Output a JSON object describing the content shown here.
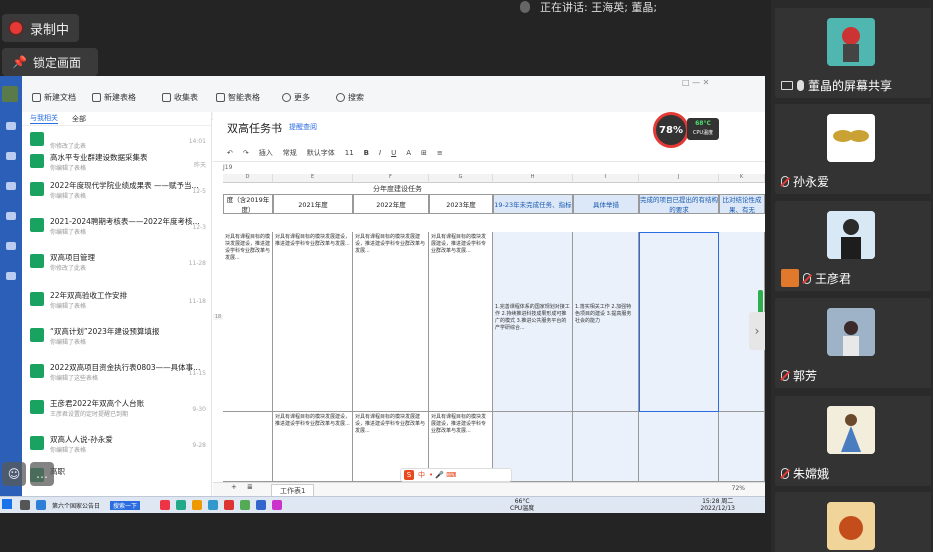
{
  "overlay": {
    "recording_label": "录制中",
    "lock_label": "锁定画面",
    "speaking_label": "正在讲话: 王海英; 董晶;"
  },
  "shared_app": {
    "toolbar": {
      "new_doc": "新建文档",
      "new_sheet": "新建表格",
      "inbox": "收集表",
      "smart_table": "智能表格",
      "more": "更多",
      "search": "搜索"
    },
    "doclist": {
      "tabs": [
        "与我相关",
        "全部"
      ],
      "items": [
        {
          "title": "",
          "sub": "你修改了此表",
          "date": "14:01"
        },
        {
          "title": "高水平专业群建设数据采集表",
          "sub": "你编辑了表格",
          "date": "昨天"
        },
        {
          "title": "2022年度现代学院业绩成果表 ——赋予当...",
          "sub": "你编辑了表格",
          "date": "12-5"
        },
        {
          "title": "2021-2024聘期考核表——2022年度考核...",
          "sub": "你编辑了表格",
          "date": "12-3"
        },
        {
          "title": "双高项目管理",
          "sub": "你修改了此表",
          "date": "11-28"
        },
        {
          "title": "22年双高验收工作安排",
          "sub": "你编辑了表格",
          "date": "11-18"
        },
        {
          "title": "“双高计划”2023年建设预算填报",
          "sub": "你编辑了表格",
          "date": ""
        },
        {
          "title": "2022双高项目资金执行表0803——具体事...",
          "sub": "你编辑了这些表格",
          "date": "11-15"
        },
        {
          "title": "王彦君2022年双高个人台账",
          "sub": "王彦君设置的定时提醒已到期",
          "date": "9-30"
        },
        {
          "title": "双高人人说-孙永爱",
          "sub": "你编辑了表格",
          "date": "9-28"
        },
        {
          "title": "高职",
          "sub": "",
          "date": ""
        }
      ]
    },
    "sheet": {
      "title": "双高任务书",
      "tag": "提醒查阅",
      "cell_ref": "J19",
      "cpu_percent": "78%",
      "cpu_temp": "68°C",
      "cpu_temp_label": "CPU温度",
      "format": {
        "insert": "插入",
        "style": "常规",
        "font": "默认字体",
        "size": "11"
      },
      "header_title": "分年度建设任务",
      "columns": [
        "D",
        "E",
        "F",
        "G",
        "H",
        "I",
        "J",
        "K"
      ],
      "headers": [
        "度（含2019年度）",
        "2021年度",
        "2022年度",
        "2023年度",
        "19-23年未完成任务、指标",
        "具体举措",
        "完成的项目已提出的有结构的要求",
        "比对结论性成果、有无"
      ],
      "row_number": "18",
      "row_text": "对具有课程目标的模块发展建设，推进建设学科专业群改革与发展...",
      "h_text": "1.完善课程体系的国家规划对接工作 2.持续推进科技成果形成可推广的模式 3.推进公共服务平台的产学研综合...",
      "i_text": "1.落实相关工作 2.加强特色项目的建设 3.提高服务社会的能力",
      "sheet_tab": "工作表1",
      "zoom": "72%"
    },
    "taskbar": {
      "search_label": "搜索一下",
      "cpu_temp": "66°C",
      "cpu_label": "CPU温度",
      "time": "15:28 周二",
      "date": "2022/12/13",
      "folder_label": "第六个国家公告日"
    },
    "ime": "中"
  },
  "participants": [
    {
      "name": "董晶的屏幕共享",
      "status": "sharing"
    },
    {
      "name": "孙永爱",
      "status": "muted"
    },
    {
      "name": "王彦君",
      "status": "host"
    },
    {
      "name": "郭芳",
      "status": "muted"
    },
    {
      "name": "朱嫦娥",
      "status": "muted"
    },
    {
      "name": "",
      "status": "muted"
    }
  ]
}
